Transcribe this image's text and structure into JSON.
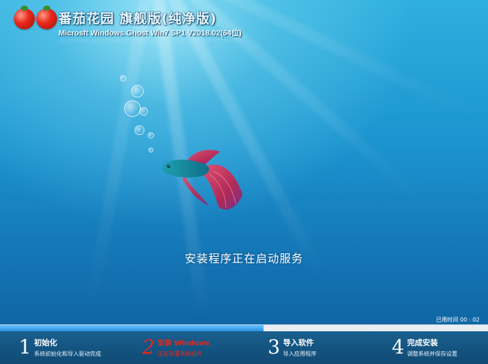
{
  "header": {
    "logo_icon": "tomato-logo-icon",
    "title": "番茄花园 旗舰版(纯净版)",
    "subtitle": "Microsft Windows.Ghost Win7 SP1 V2018.02(64位)"
  },
  "status": {
    "message": "安装程序正在启动服务",
    "elapsed_label": "已用时间",
    "elapsed_value": "00 : 02"
  },
  "progress": {
    "fraction": 0.54,
    "fill_color": "#2a8ee0"
  },
  "steps": [
    {
      "number": "1",
      "title": "初始化",
      "description": "系统初始化和导入驱动完成",
      "active": false
    },
    {
      "number": "2",
      "title": "安装 Windows",
      "description": "正在部署系统组件",
      "active": true
    },
    {
      "number": "3",
      "title": "导入软件",
      "description": "导入应用程序",
      "active": false
    },
    {
      "number": "4",
      "title": "完成安装",
      "description": "调整系统并保存设置",
      "active": false
    }
  ],
  "colors": {
    "active_step": "#e8271d",
    "bar_background": "#0f4a74"
  }
}
